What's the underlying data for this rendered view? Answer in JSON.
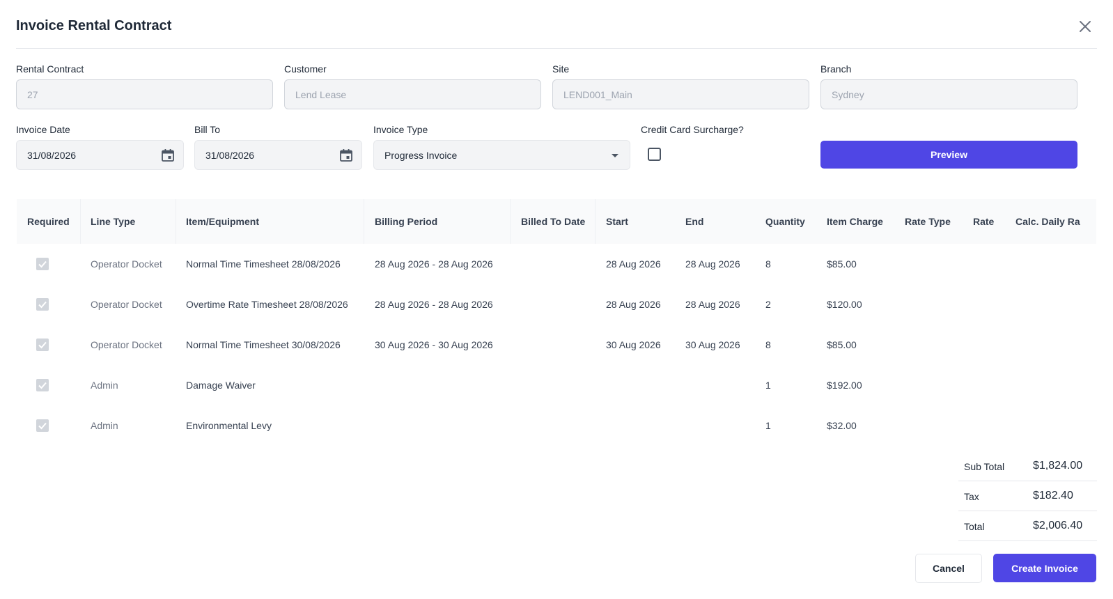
{
  "dialog": {
    "title": "Invoice Rental Contract"
  },
  "fields": {
    "rental_contract": {
      "label": "Rental Contract",
      "value": "27"
    },
    "customer": {
      "label": "Customer",
      "value": "Lend Lease"
    },
    "site": {
      "label": "Site",
      "value": "LEND001_Main"
    },
    "branch": {
      "label": "Branch",
      "value": "Sydney"
    },
    "invoice_date": {
      "label": "Invoice Date",
      "value": "31/08/2026"
    },
    "bill_to": {
      "label": "Bill To",
      "value": "31/08/2026"
    },
    "invoice_type": {
      "label": "Invoice Type",
      "value": "Progress Invoice"
    },
    "credit_card_surcharge": {
      "label": "Credit Card Surcharge?",
      "checked": false
    }
  },
  "actions": {
    "preview": "Preview",
    "cancel": "Cancel",
    "create": "Create Invoice"
  },
  "table": {
    "columns": [
      "Required",
      "Line Type",
      "Item/Equipment",
      "Billing Period",
      "Billed To Date",
      "Start",
      "End",
      "Quantity",
      "Item Charge",
      "Rate Type",
      "Rate",
      "Calc. Daily Ra"
    ],
    "rows": [
      {
        "required": true,
        "line_type": "Operator Docket",
        "item": "Normal Time Timesheet 28/08/2026",
        "billing_period": "28 Aug 2026 - 28 Aug 2026",
        "billed_to_date": "",
        "start": "28 Aug 2026",
        "end": "28 Aug 2026",
        "quantity": "8",
        "item_charge": "$85.00"
      },
      {
        "required": true,
        "line_type": "Operator Docket",
        "item": "Overtime Rate Timesheet 28/08/2026",
        "billing_period": "28 Aug 2026 - 28 Aug 2026",
        "billed_to_date": "",
        "start": "28 Aug 2026",
        "end": "28 Aug 2026",
        "quantity": "2",
        "item_charge": "$120.00"
      },
      {
        "required": true,
        "line_type": "Operator Docket",
        "item": "Normal Time Timesheet 30/08/2026",
        "billing_period": "30 Aug 2026 - 30 Aug 2026",
        "billed_to_date": "",
        "start": "30 Aug 2026",
        "end": "30 Aug 2026",
        "quantity": "8",
        "item_charge": "$85.00"
      },
      {
        "required": true,
        "line_type": "Admin",
        "item": "Damage Waiver",
        "billing_period": "",
        "billed_to_date": "",
        "start": "",
        "end": "",
        "quantity": "1",
        "item_charge": "$192.00"
      },
      {
        "required": true,
        "line_type": "Admin",
        "item": "Environmental Levy",
        "billing_period": "",
        "billed_to_date": "",
        "start": "",
        "end": "",
        "quantity": "1",
        "item_charge": "$32.00"
      }
    ]
  },
  "totals": {
    "subtotal": {
      "label": "Sub Total",
      "value": "$1,824.00"
    },
    "tax": {
      "label": "Tax",
      "value": "$182.40"
    },
    "total": {
      "label": "Total",
      "value": "$2,006.40"
    }
  },
  "colors": {
    "primary": "#4f46e5",
    "input_bg": "#f3f4f6",
    "border": "#e5e7eb"
  }
}
